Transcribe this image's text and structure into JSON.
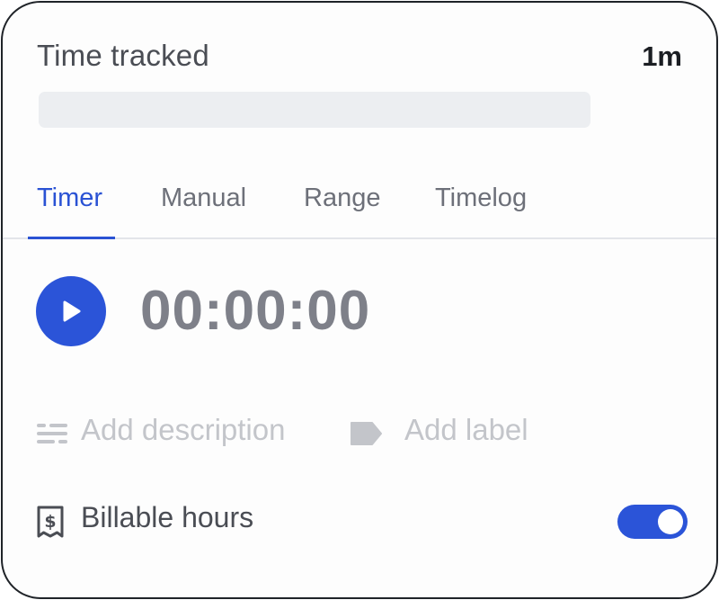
{
  "header": {
    "title": "Time tracked",
    "value": "1m",
    "progress_fraction": 0
  },
  "tabs": [
    {
      "label": "Timer",
      "active": true
    },
    {
      "label": "Manual",
      "active": false
    },
    {
      "label": "Range",
      "active": false
    },
    {
      "label": "Timelog",
      "active": false
    }
  ],
  "timer": {
    "display": "00:00:00",
    "play_icon": "play-icon"
  },
  "inputs": {
    "description_placeholder": "Add description",
    "description_icon": "description-lines-icon",
    "label_placeholder": "Add label",
    "label_icon": "tag-icon"
  },
  "billable": {
    "label": "Billable hours",
    "icon": "receipt-dollar-icon",
    "enabled": true
  },
  "colors": {
    "accent": "#2b54d8",
    "text_primary": "#1b1e23",
    "text_secondary": "#4a4d54",
    "text_muted": "#c3c5ca",
    "timer_text": "#7e8089"
  }
}
